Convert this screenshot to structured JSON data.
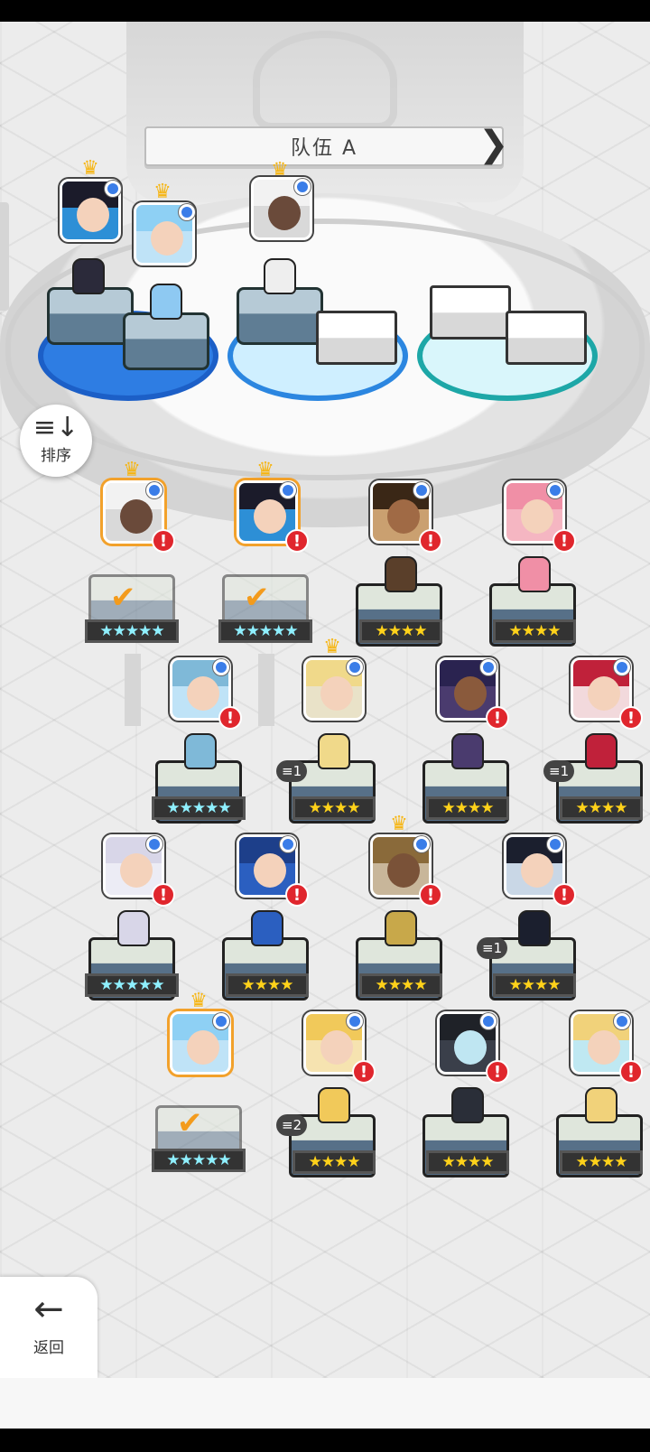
{
  "team": {
    "title": "队伍 A",
    "prev_arrow": "❮",
    "next_arrow": "❯"
  },
  "sort_button": {
    "icon": "≡↓",
    "label": "排序"
  },
  "back_button": {
    "icon": "←",
    "label": "返回"
  },
  "colors": {
    "selected_border": "#f2a12b",
    "alert": "#e0262d",
    "info_dot": "#3a7de8",
    "crown": "#f6b512"
  },
  "icons": {
    "crown": "crown-icon",
    "alert": "exclamation-icon",
    "check": "checkmark-icon",
    "dot": "info-dot-icon"
  },
  "roster": {
    "alert_text": "!",
    "check_text": "✔",
    "crown_text": "♛",
    "stars_5": "★★★★★",
    "stars_4": "★★★★",
    "badge_1": "≡1",
    "badge_2": "≡2"
  }
}
